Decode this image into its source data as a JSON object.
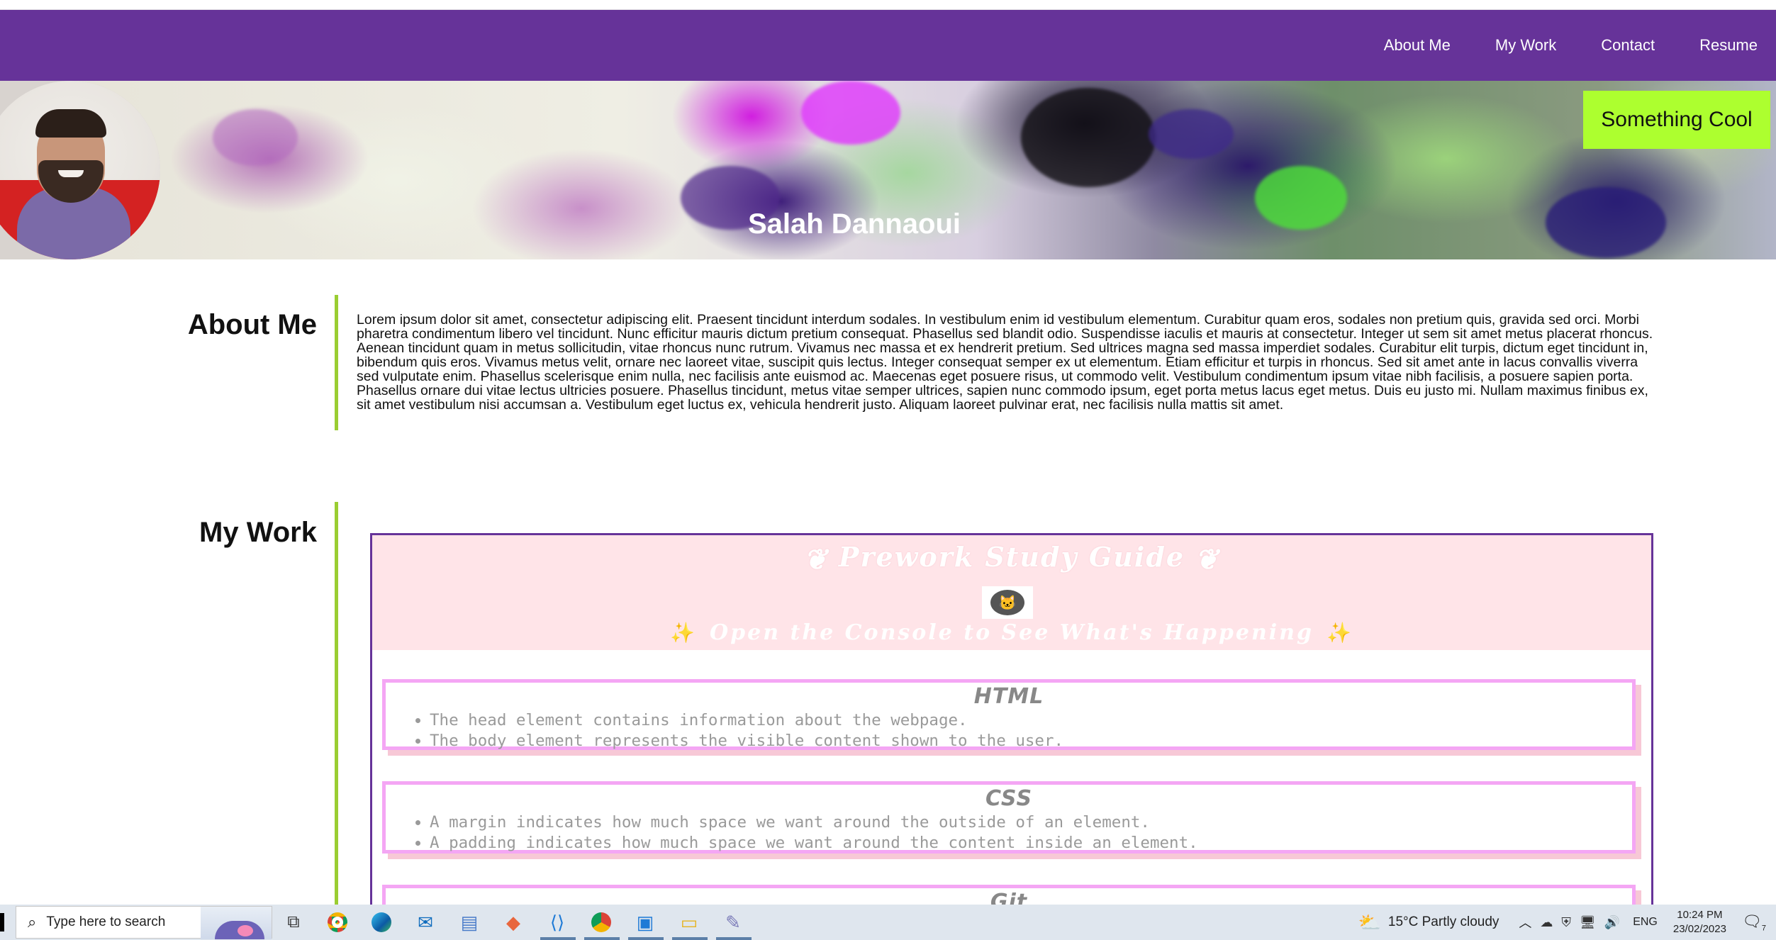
{
  "nav": {
    "items": [
      {
        "label": "About Me"
      },
      {
        "label": "My Work"
      },
      {
        "label": "Contact"
      },
      {
        "label": "Resume"
      }
    ]
  },
  "hero": {
    "name": "Salah Dannaoui",
    "cool_button": "Something Cool"
  },
  "about": {
    "heading": "About Me",
    "body": "Lorem ipsum dolor sit amet, consectetur adipiscing elit. Praesent tincidunt interdum sodales. In vestibulum enim id vestibulum elementum. Curabitur quam eros, sodales non pretium quis, gravida sed orci. Morbi pharetra condimentum libero vel tincidunt. Nunc efficitur mauris dictum pretium consequat. Phasellus sed blandit odio. Suspendisse iaculis et mauris at consectetur. Integer ut sem sit amet metus placerat rhoncus. Aenean tincidunt quam in metus sollicitudin, vitae rhoncus nunc rutrum. Vivamus nec massa et ex hendrerit pretium. Sed ultrices magna sed massa imperdiet sodales. Curabitur elit turpis, dictum eget tincidunt in, bibendum quis eros. Vivamus metus velit, ornare nec laoreet vitae, suscipit quis lectus. Integer consequat semper ex ut elementum. Etiam efficitur et turpis in rhoncus. Sed sit amet ante in lacus convallis viverra sed vulputate enim. Phasellus scelerisque enim nulla, nec facilisis ante euismod ac. Maecenas eget posuere risus, ut commodo velit. Vestibulum condimentum ipsum vitae nibh facilisis, a posuere sapien porta. Phasellus ornare dui vitae lectus ultricies posuere. Phasellus tincidunt, metus vitae semper ultrices, sapien nunc commodo ipsum, eget porta metus lacus eget metus. Duis eu justo mi. Nullam maximus finibus ex, sit amet vestibulum nisi accumsan a. Vestibulum eget luctus ex, vehicula hendrerit justo. Aliquam laoreet pulvinar erat, nec facilisis nulla mattis sit amet."
  },
  "work": {
    "heading": "My Work",
    "preview": {
      "title": "Prework Study Guide",
      "subtitle": "Open the Console to See What's Happening",
      "cards": [
        {
          "title": "HTML",
          "items": [
            "The head element contains information about the webpage.",
            "The body element represents the visible content shown to the user."
          ]
        },
        {
          "title": "CSS",
          "items": [
            "A margin indicates how much space we want around the outside of an element.",
            "A padding indicates how much space we want around the content inside an element."
          ]
        },
        {
          "title": "Git",
          "items": []
        }
      ]
    }
  },
  "taskbar": {
    "search_placeholder": "Type here to search",
    "weather": "15°C  Partly cloudy",
    "language": "ENG",
    "time": "10:24 PM",
    "date": "23/02/2023",
    "notification_count": "7"
  },
  "colors": {
    "nav_bg": "#663399",
    "accent_green": "#adff2f",
    "rule_green": "#9acd32",
    "card_border": "#f4a6f4",
    "preview_header_bg": "#ffe4e8"
  }
}
